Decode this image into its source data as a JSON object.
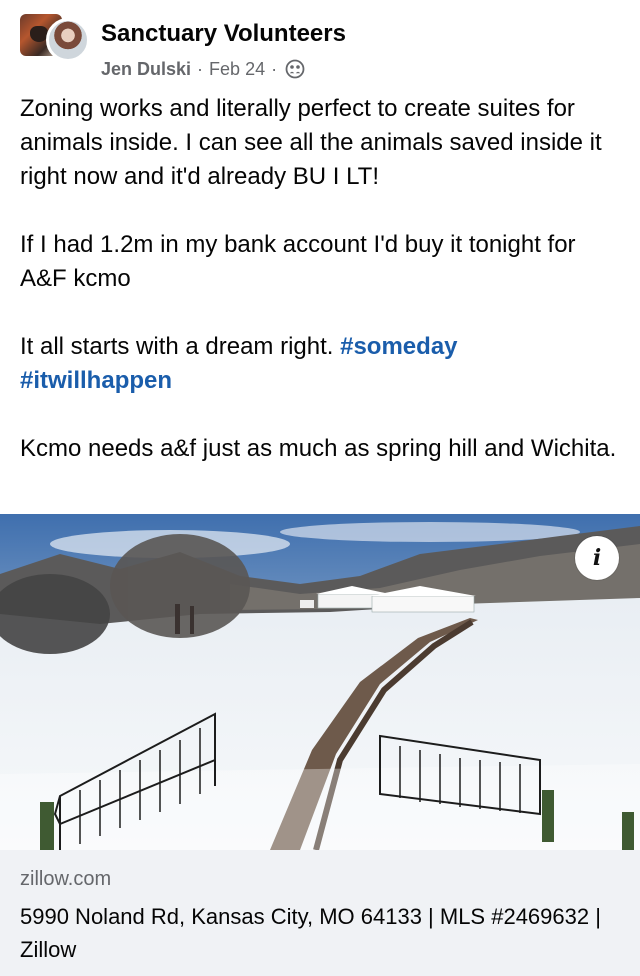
{
  "post": {
    "group_name": "Sanctuary Volunteers",
    "author": "Jen Dulski",
    "separator": "·",
    "date": "Feb 24",
    "audience_icon": "group-audience-icon",
    "paragraphs": {
      "p1": "Zoning works and literally perfect to create suites for animals inside. I can see all the animals saved inside it right now and it'd already BU I LT!",
      "p2": "If I had 1.2m in my bank account I'd buy it tonight for A&F kcmo",
      "p3_text": "It all starts with a dream right. ",
      "p3_hashtag1": "#someday",
      "p3_hashtag2": "#itwillhappen",
      "p4": "Kcmo needs a&f just as much as spring hill and Wichita."
    },
    "hashtag_color": "#1a5dab"
  },
  "link_preview": {
    "info_icon": "info-icon",
    "domain": "zillow.com",
    "title": "5990 Noland Rd, Kansas City, MO 64133 | MLS #2469632 | Zillow"
  },
  "colors": {
    "text_primary": "#050505",
    "text_secondary": "#65676b",
    "preview_background": "#f0f2f5"
  }
}
